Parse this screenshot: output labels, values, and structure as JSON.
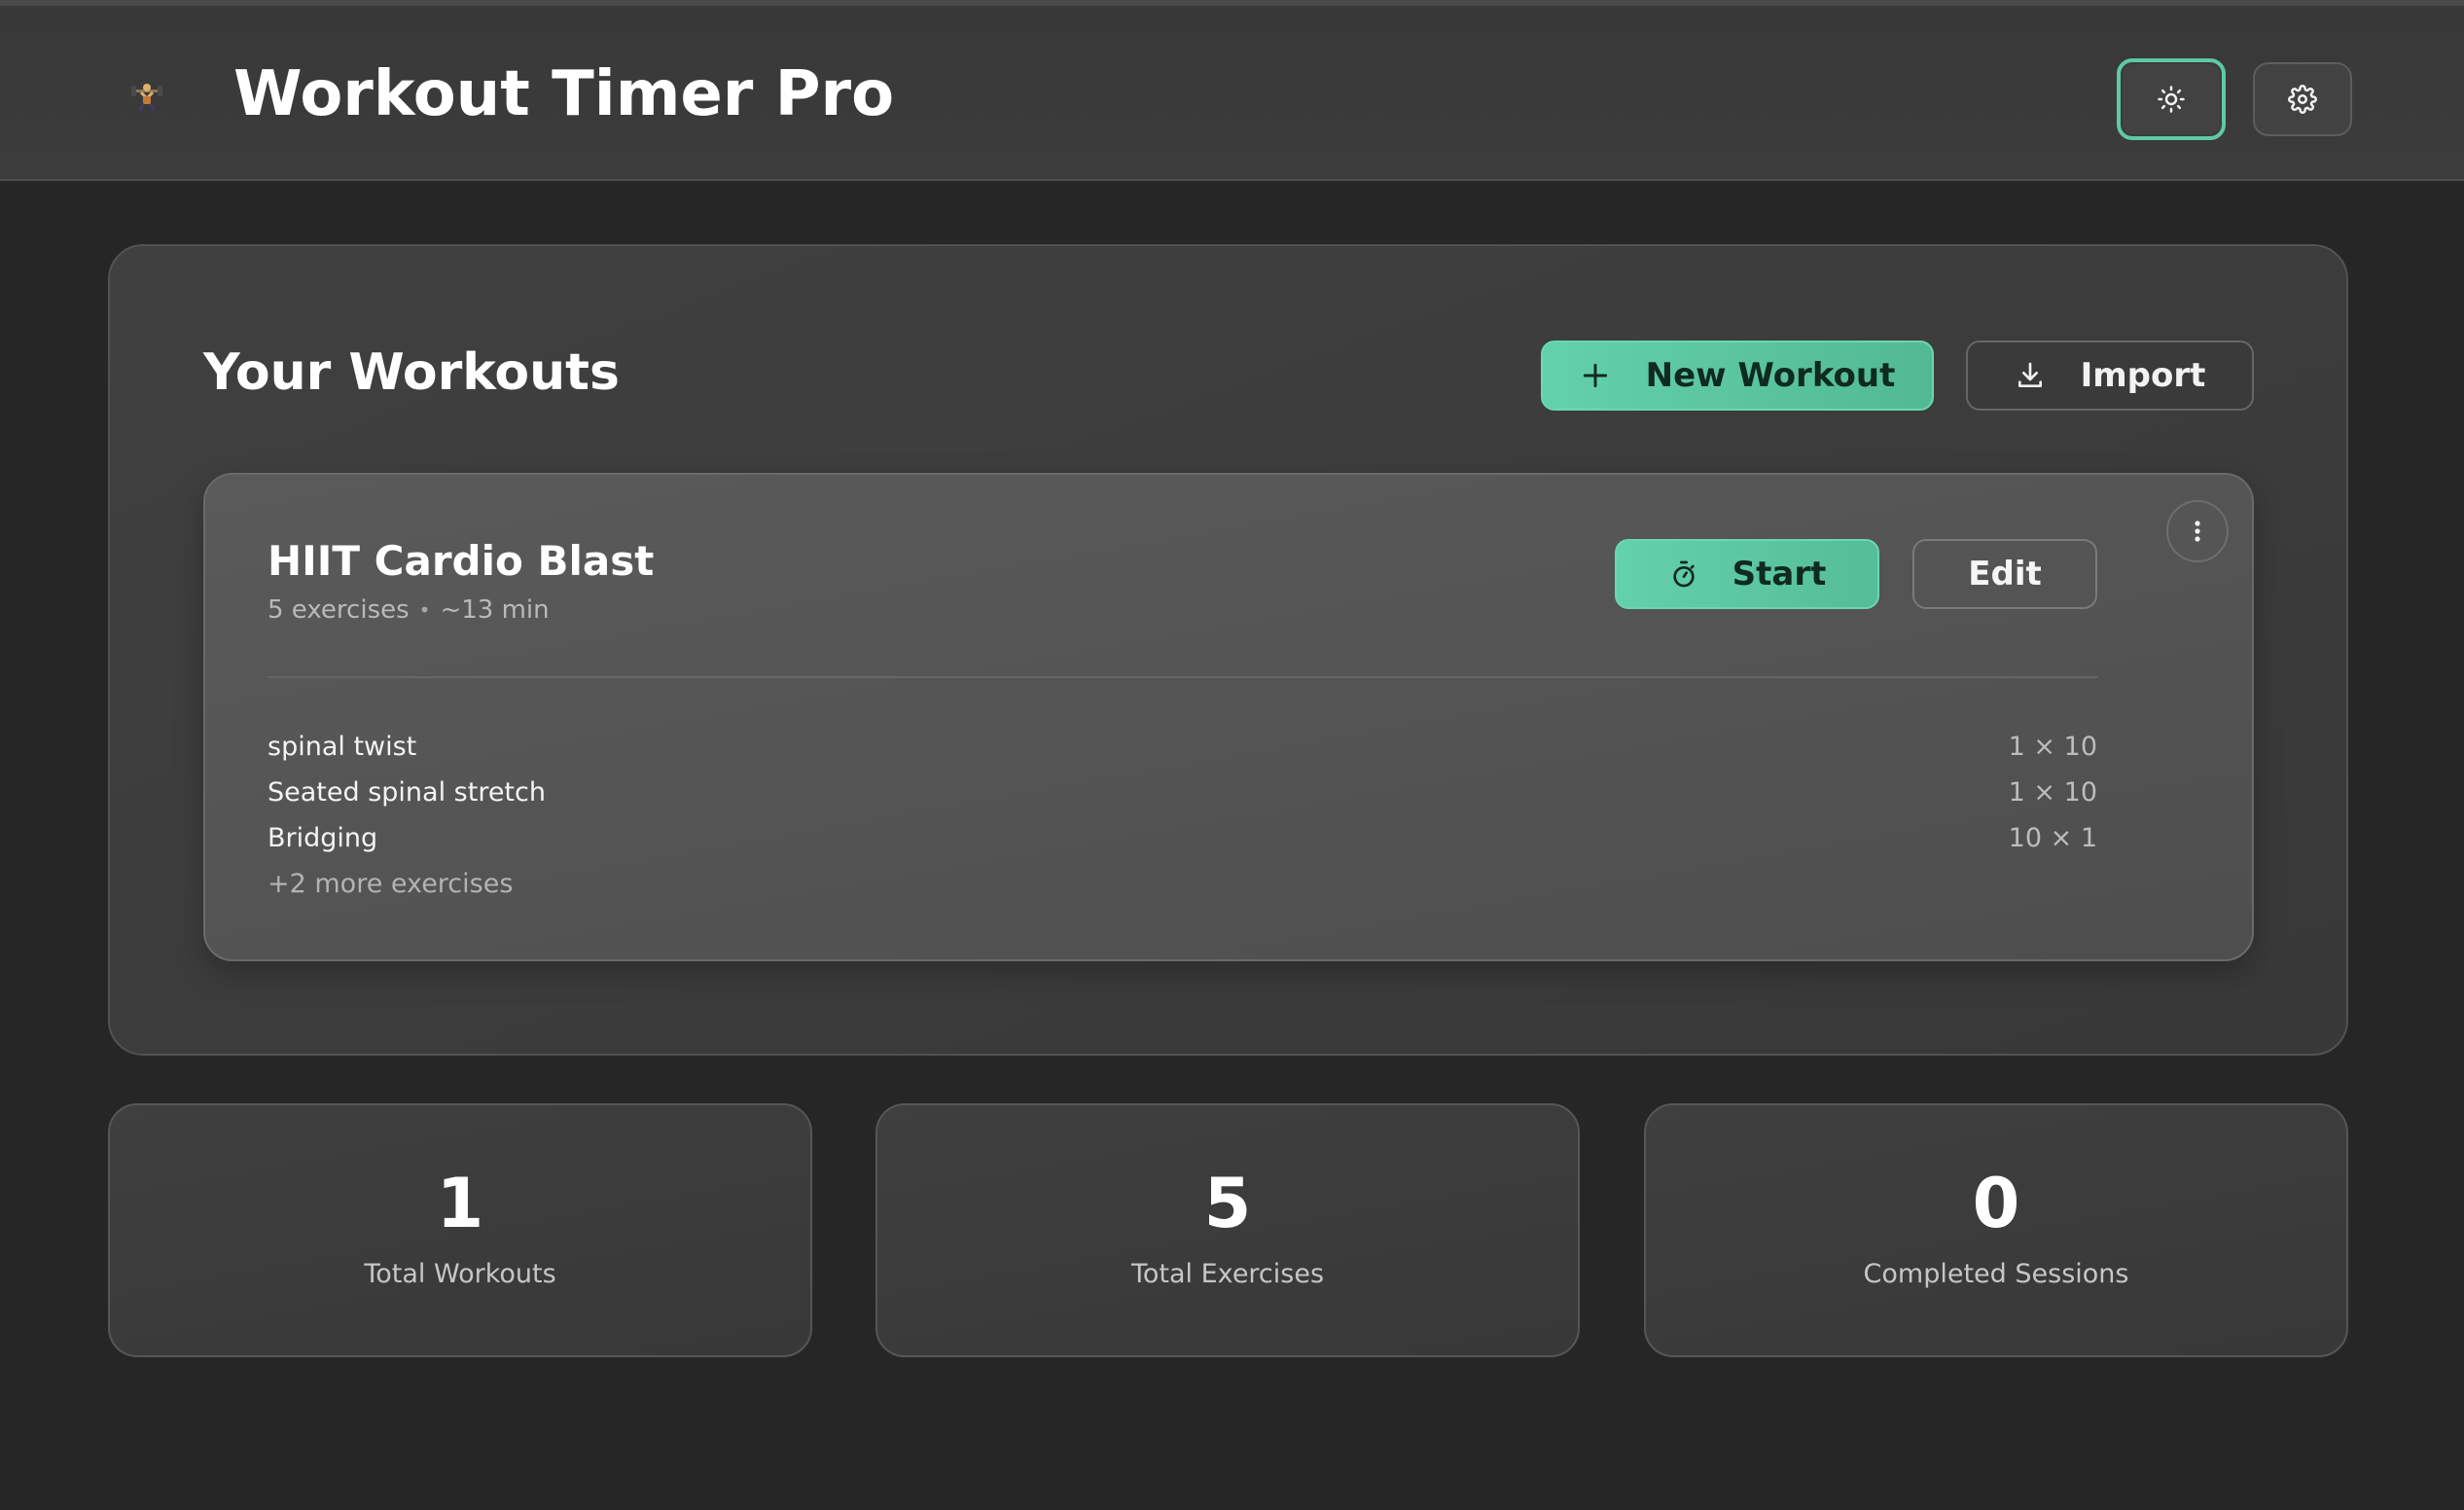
{
  "app": {
    "title": "Workout Timer Pro",
    "logo_icon": "weightlifter-icon"
  },
  "header": {
    "theme_toggle_icon": "sun-icon",
    "settings_icon": "gear-icon"
  },
  "workouts_panel": {
    "title": "Your Workouts",
    "new_workout_label": "New Workout",
    "import_label": "Import"
  },
  "workouts": [
    {
      "title": "HIIT Cardio Blast",
      "exercise_count": "5 exercises",
      "duration": "~13 min",
      "start_label": "Start",
      "edit_label": "Edit",
      "exercises": [
        {
          "name": "spinal twist",
          "sets": "1 × 10"
        },
        {
          "name": "Seated spinal stretch",
          "sets": "1 × 10"
        },
        {
          "name": "Bridging",
          "sets": "10 × 1"
        }
      ],
      "more_text": "+2 more exercises"
    }
  ],
  "stats": [
    {
      "value": "1",
      "label": "Total Workouts"
    },
    {
      "value": "5",
      "label": "Total Exercises"
    },
    {
      "value": "0",
      "label": "Completed Sessions"
    }
  ],
  "colors": {
    "accent": "#5ec9a5",
    "background": "#262626",
    "panel": "#3c3c3c",
    "card": "#555555"
  }
}
